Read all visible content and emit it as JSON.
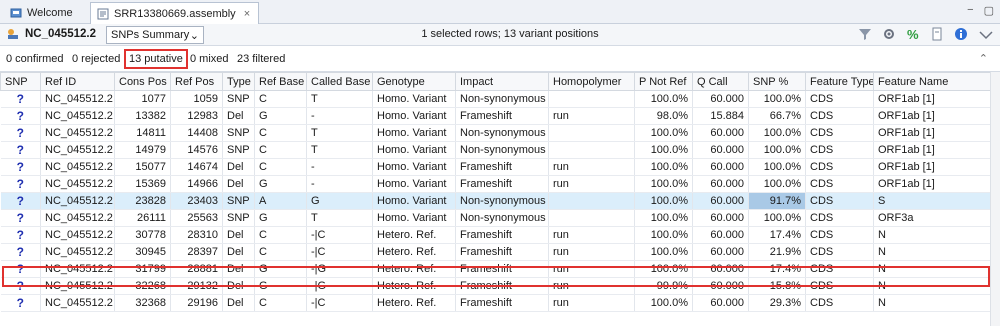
{
  "tabs": [
    {
      "label": "Welcome",
      "icon": "workbench-icon"
    },
    {
      "label": "SRR13380669.assembly",
      "icon": "assembly-icon",
      "close": "×"
    }
  ],
  "window_controls": {
    "minimize": "−",
    "maximize": "▢"
  },
  "toolbar": {
    "sequence_name": "NC_045512.2",
    "view_select": "SNPs Summary",
    "status": "1 selected rows; 13 variant positions"
  },
  "filters": {
    "confirmed": "0 confirmed",
    "rejected": "0 rejected",
    "putative": "13 putative",
    "mixed": "0 mixed",
    "filtered": "23 filtered"
  },
  "table": {
    "headers": [
      "SNP",
      "Ref ID",
      "Cons Pos",
      "Ref Pos",
      "Type",
      "Ref Base",
      "Called Base",
      "Genotype",
      "Impact",
      "Homopolymer",
      "P Not Ref",
      "Q Call",
      "SNP %",
      "Feature Type",
      "Feature Name"
    ],
    "rows": [
      [
        "?",
        "NC_045512.2",
        "1077",
        "1059",
        "SNP",
        "C",
        "T",
        "Homo. Variant",
        "Non-synonymous",
        "",
        "100.0%",
        "60.000",
        "100.0%",
        "CDS",
        "ORF1ab [1]"
      ],
      [
        "?",
        "NC_045512.2",
        "13382",
        "12983",
        "Del",
        "G",
        "-",
        "Homo. Variant",
        "Frameshift",
        "run",
        "98.0%",
        "15.884",
        "66.7%",
        "CDS",
        "ORF1ab [1]"
      ],
      [
        "?",
        "NC_045512.2",
        "14811",
        "14408",
        "SNP",
        "C",
        "T",
        "Homo. Variant",
        "Non-synonymous",
        "",
        "100.0%",
        "60.000",
        "100.0%",
        "CDS",
        "ORF1ab [1]"
      ],
      [
        "?",
        "NC_045512.2",
        "14979",
        "14576",
        "SNP",
        "C",
        "T",
        "Homo. Variant",
        "Non-synonymous",
        "",
        "100.0%",
        "60.000",
        "100.0%",
        "CDS",
        "ORF1ab [1]"
      ],
      [
        "?",
        "NC_045512.2",
        "15077",
        "14674",
        "Del",
        "C",
        "-",
        "Homo. Variant",
        "Frameshift",
        "run",
        "100.0%",
        "60.000",
        "100.0%",
        "CDS",
        "ORF1ab [1]"
      ],
      [
        "?",
        "NC_045512.2",
        "15369",
        "14966",
        "Del",
        "G",
        "-",
        "Homo. Variant",
        "Frameshift",
        "run",
        "100.0%",
        "60.000",
        "100.0%",
        "CDS",
        "ORF1ab [1]"
      ],
      [
        "?",
        "NC_045512.2",
        "23828",
        "23403",
        "SNP",
        "A",
        "G",
        "Homo. Variant",
        "Non-synonymous",
        "",
        "100.0%",
        "60.000",
        "91.7%",
        "CDS",
        "S"
      ],
      [
        "?",
        "NC_045512.2",
        "26111",
        "25563",
        "SNP",
        "G",
        "T",
        "Homo. Variant",
        "Non-synonymous",
        "",
        "100.0%",
        "60.000",
        "100.0%",
        "CDS",
        "ORF3a"
      ],
      [
        "?",
        "NC_045512.2",
        "30778",
        "28310",
        "Del",
        "C",
        "-|C",
        "Hetero. Ref.",
        "Frameshift",
        "run",
        "100.0%",
        "60.000",
        "17.4%",
        "CDS",
        "N"
      ],
      [
        "?",
        "NC_045512.2",
        "30945",
        "28397",
        "Del",
        "C",
        "-|C",
        "Hetero. Ref.",
        "Frameshift",
        "run",
        "100.0%",
        "60.000",
        "21.9%",
        "CDS",
        "N"
      ],
      [
        "?",
        "NC_045512.2",
        "31799",
        "28881",
        "Del",
        "G",
        "-|G",
        "Hetero. Ref.",
        "Frameshift",
        "run",
        "100.0%",
        "60.000",
        "17.4%",
        "CDS",
        "N"
      ],
      [
        "?",
        "NC_045512.2",
        "32268",
        "29132",
        "Del",
        "G",
        "-|G",
        "Hetero. Ref.",
        "Frameshift",
        "run",
        "99.9%",
        "60.000",
        "15.8%",
        "CDS",
        "N"
      ],
      [
        "?",
        "NC_045512.2",
        "32368",
        "29196",
        "Del",
        "C",
        "-|C",
        "Hetero. Ref.",
        "Frameshift",
        "run",
        "100.0%",
        "60.000",
        "29.3%",
        "CDS",
        "N"
      ]
    ],
    "selected_row": 6
  },
  "colors": {
    "highlight": "#e0322f",
    "selection": "#dbeefb",
    "putative_icon": "#1f2fb0"
  }
}
